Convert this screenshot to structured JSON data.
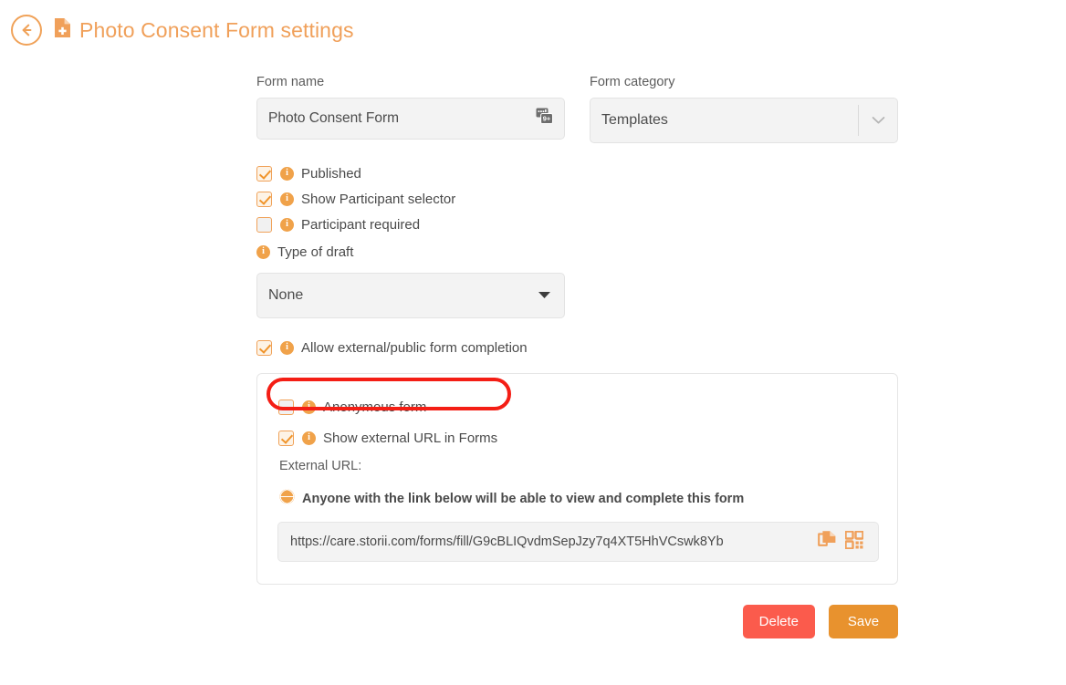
{
  "header": {
    "back_icon": "back-arrow-icon",
    "doc_icon": "form-add-icon",
    "title": "Photo Consent Form settings"
  },
  "form": {
    "name_label": "Form name",
    "name_value": "Photo Consent Form",
    "name_placeholder": "Form name",
    "name_trailing_icon": "translations-icon",
    "category_label": "Form category",
    "category_value": "Templates",
    "category_options": [
      "Templates"
    ],
    "category_chevron_icon": "chevron-down-icon"
  },
  "options": [
    {
      "label": "Published",
      "checked": true,
      "info_icon": "info-icon"
    },
    {
      "label": "Show Participant selector",
      "checked": true,
      "info_icon": "info-icon"
    },
    {
      "label": "Participant required",
      "checked": false,
      "info_icon": "info-icon"
    }
  ],
  "draft": {
    "label": "Type of draft",
    "info_icon": "info-icon",
    "value": "None",
    "options": [
      "None"
    ],
    "chevron_icon": "caret-down-icon"
  },
  "external": {
    "allow_label": "Allow external/public form completion",
    "allow_checked": true,
    "allow_info_icon": "info-icon",
    "anonymous_label": "Anonymous form",
    "anonymous_checked": false,
    "anonymous_info_icon": "info-icon",
    "show_url_label": "Show external URL in Forms",
    "show_url_checked": true,
    "show_url_info_icon": "info-icon",
    "url_label": "External URL:",
    "warning_icon": "globe-icon",
    "warning_text": "Anyone with the link below will be able to view and complete this form",
    "url_value": "https://care.storii.com/forms/fill/G9cBLIQvdmSepJzy7q4XT5HhVCswk8Yb",
    "copy_icon": "copy-icon",
    "qr_icon": "qr-code-icon"
  },
  "buttons": {
    "delete_label": "Delete",
    "save_label": "Save"
  },
  "annotation": {
    "target": "show-external-url-in-forms-checkbox",
    "color": "#f41e15"
  },
  "colors": {
    "accent_orange": "#f0a05a",
    "checkbox_orange": "#f0a259",
    "delete_red": "#fb5b4c",
    "save_orange": "#e8922e",
    "annotation_red": "#f41e15"
  }
}
